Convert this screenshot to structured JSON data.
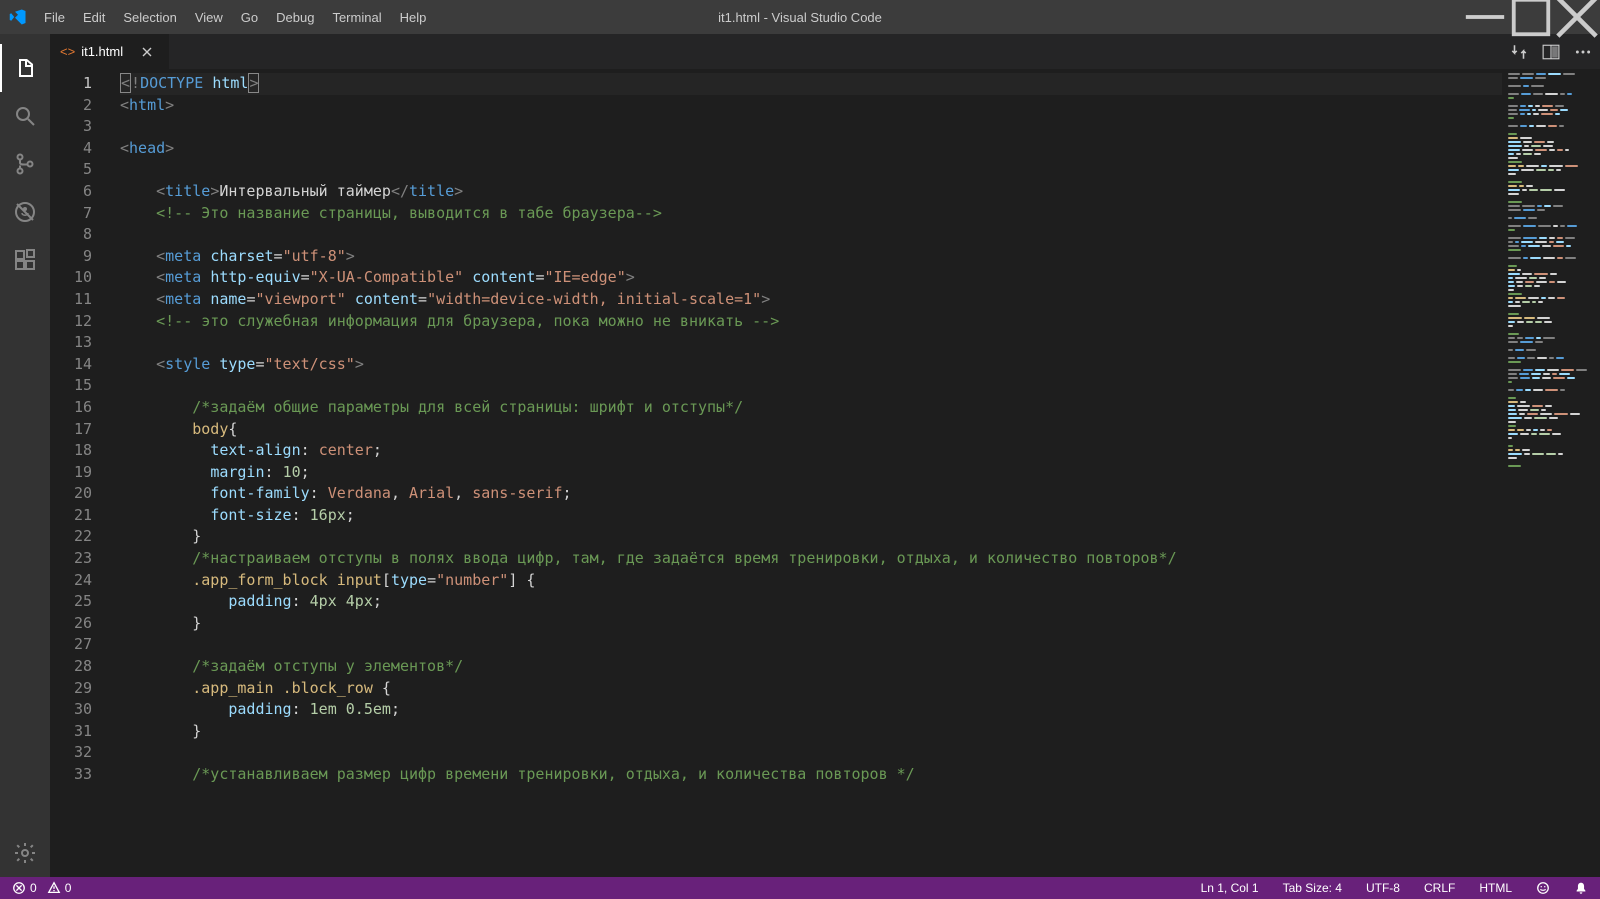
{
  "menubar": [
    "File",
    "Edit",
    "Selection",
    "View",
    "Go",
    "Debug",
    "Terminal",
    "Help"
  ],
  "window_title": "it1.html - Visual Studio Code",
  "tab": {
    "icon": "<>",
    "label": "it1.html"
  },
  "activity": {
    "files": "explorer-icon",
    "search": "search-icon",
    "scm": "source-control-icon",
    "debug": "debug-icon",
    "ext": "extensions-icon",
    "settings": "settings-gear-icon"
  },
  "statusbar": {
    "errors": "0",
    "warnings": "0",
    "cursor": "Ln 1, Col 1",
    "tabsize": "Tab Size: 4",
    "encoding": "UTF-8",
    "eol": "CRLF",
    "language": "HTML"
  },
  "code": {
    "line_count": 33,
    "current_line": 1,
    "lines": [
      {
        "n": 1,
        "html": "<span class='br bracket-hl'>&lt;</span><span class='br'>!</span><span class='tg'>DOCTYPE</span> <span class='attr'>html</span><span class='br bracket-hl'>&gt;</span>"
      },
      {
        "n": 2,
        "html": "<span class='br'>&lt;</span><span class='tg'>html</span><span class='br'>&gt;</span>"
      },
      {
        "n": 3,
        "html": ""
      },
      {
        "n": 4,
        "html": "<span class='br'>&lt;</span><span class='tg'>head</span><span class='br'>&gt;</span>"
      },
      {
        "n": 5,
        "html": ""
      },
      {
        "n": 6,
        "html": "    <span class='br'>&lt;</span><span class='tg'>title</span><span class='br'>&gt;</span><span class='txt'>Интервальный таймер</span><span class='br'>&lt;/</span><span class='tg'>title</span><span class='br'>&gt;</span>"
      },
      {
        "n": 7,
        "html": "    <span class='cmnt'>&lt;!-- Это название страницы, выводится в табе браузера--&gt;</span>"
      },
      {
        "n": 8,
        "html": ""
      },
      {
        "n": 9,
        "html": "    <span class='br'>&lt;</span><span class='tg'>meta</span> <span class='attr'>charset</span><span class='pn'>=</span><span class='str'>\"utf-8\"</span><span class='br'>&gt;</span>"
      },
      {
        "n": 10,
        "html": "    <span class='br'>&lt;</span><span class='tg'>meta</span> <span class='attr'>http-equiv</span><span class='pn'>=</span><span class='str'>\"X-UA-Compatible\"</span> <span class='attr'>content</span><span class='pn'>=</span><span class='str'>\"IE=edge\"</span><span class='br'>&gt;</span>"
      },
      {
        "n": 11,
        "html": "    <span class='br'>&lt;</span><span class='tg'>meta</span> <span class='attr'>name</span><span class='pn'>=</span><span class='str'>\"viewport\"</span> <span class='attr'>content</span><span class='pn'>=</span><span class='str'>\"width=device-width, initial-scale=1\"</span><span class='br'>&gt;</span>"
      },
      {
        "n": 12,
        "html": "    <span class='cmnt'>&lt;!-- это служебная информация для браузера, пока можно не вникать --&gt;</span>"
      },
      {
        "n": 13,
        "html": ""
      },
      {
        "n": 14,
        "html": "    <span class='br'>&lt;</span><span class='tg'>style</span> <span class='attr'>type</span><span class='pn'>=</span><span class='str'>\"text/css\"</span><span class='br'>&gt;</span>"
      },
      {
        "n": 15,
        "html": ""
      },
      {
        "n": 16,
        "html": "        <span class='cmnt'>/*задаём общие параметры для всей страницы: шрифт и отступы*/</span>"
      },
      {
        "n": 17,
        "html": "        <span class='sel'>body</span><span class='pn'>{</span>"
      },
      {
        "n": 18,
        "html": "          <span class='prop'>text-align</span><span class='pn'>:</span> <span class='val'>center</span><span class='pn'>;</span>"
      },
      {
        "n": 19,
        "html": "          <span class='prop'>margin</span><span class='pn'>:</span> <span class='num'>10</span><span class='pn'>;</span>"
      },
      {
        "n": 20,
        "html": "          <span class='prop'>font-family</span><span class='pn'>:</span> <span class='val'>Verdana</span><span class='pn'>,</span> <span class='val'>Arial</span><span class='pn'>,</span> <span class='val'>sans-serif</span><span class='pn'>;</span>"
      },
      {
        "n": 21,
        "html": "          <span class='prop'>font-size</span><span class='pn'>:</span> <span class='num'>16px</span><span class='pn'>;</span>"
      },
      {
        "n": 22,
        "html": "        <span class='pn'>}</span>"
      },
      {
        "n": 23,
        "html": "        <span class='cmnt'>/*настраиваем отступы в полях ввода цифр, там, где задаётся время тренировки, отдыха, и количество повторов*/</span>"
      },
      {
        "n": 24,
        "html": "        <span class='sel'>.app_form_block</span> <span class='sel'>input</span><span class='pn'>[</span><span class='attr'>type</span><span class='pn'>=</span><span class='str'>\"number\"</span><span class='pn'>]</span> <span class='pn'>{</span>"
      },
      {
        "n": 25,
        "html": "            <span class='prop'>padding</span><span class='pn'>:</span> <span class='num'>4px</span> <span class='num'>4px</span><span class='pn'>;</span>"
      },
      {
        "n": 26,
        "html": "        <span class='pn'>}</span>"
      },
      {
        "n": 27,
        "html": ""
      },
      {
        "n": 28,
        "html": "        <span class='cmnt'>/*задаём отступы у элементов*/</span>"
      },
      {
        "n": 29,
        "html": "        <span class='sel'>.app_main</span> <span class='sel'>.block_row</span> <span class='pn'>{</span>"
      },
      {
        "n": 30,
        "html": "            <span class='prop'>padding</span><span class='pn'>:</span> <span class='num'>1em</span> <span class='num'>0.5em</span><span class='pn'>;</span>"
      },
      {
        "n": 31,
        "html": "        <span class='pn'>}</span>"
      },
      {
        "n": 32,
        "html": ""
      },
      {
        "n": 33,
        "html": "        <span class='cmnt'>/*устанавливаем размер цифр времени тренировки, отдыха, и количества повторов */</span>"
      }
    ]
  }
}
